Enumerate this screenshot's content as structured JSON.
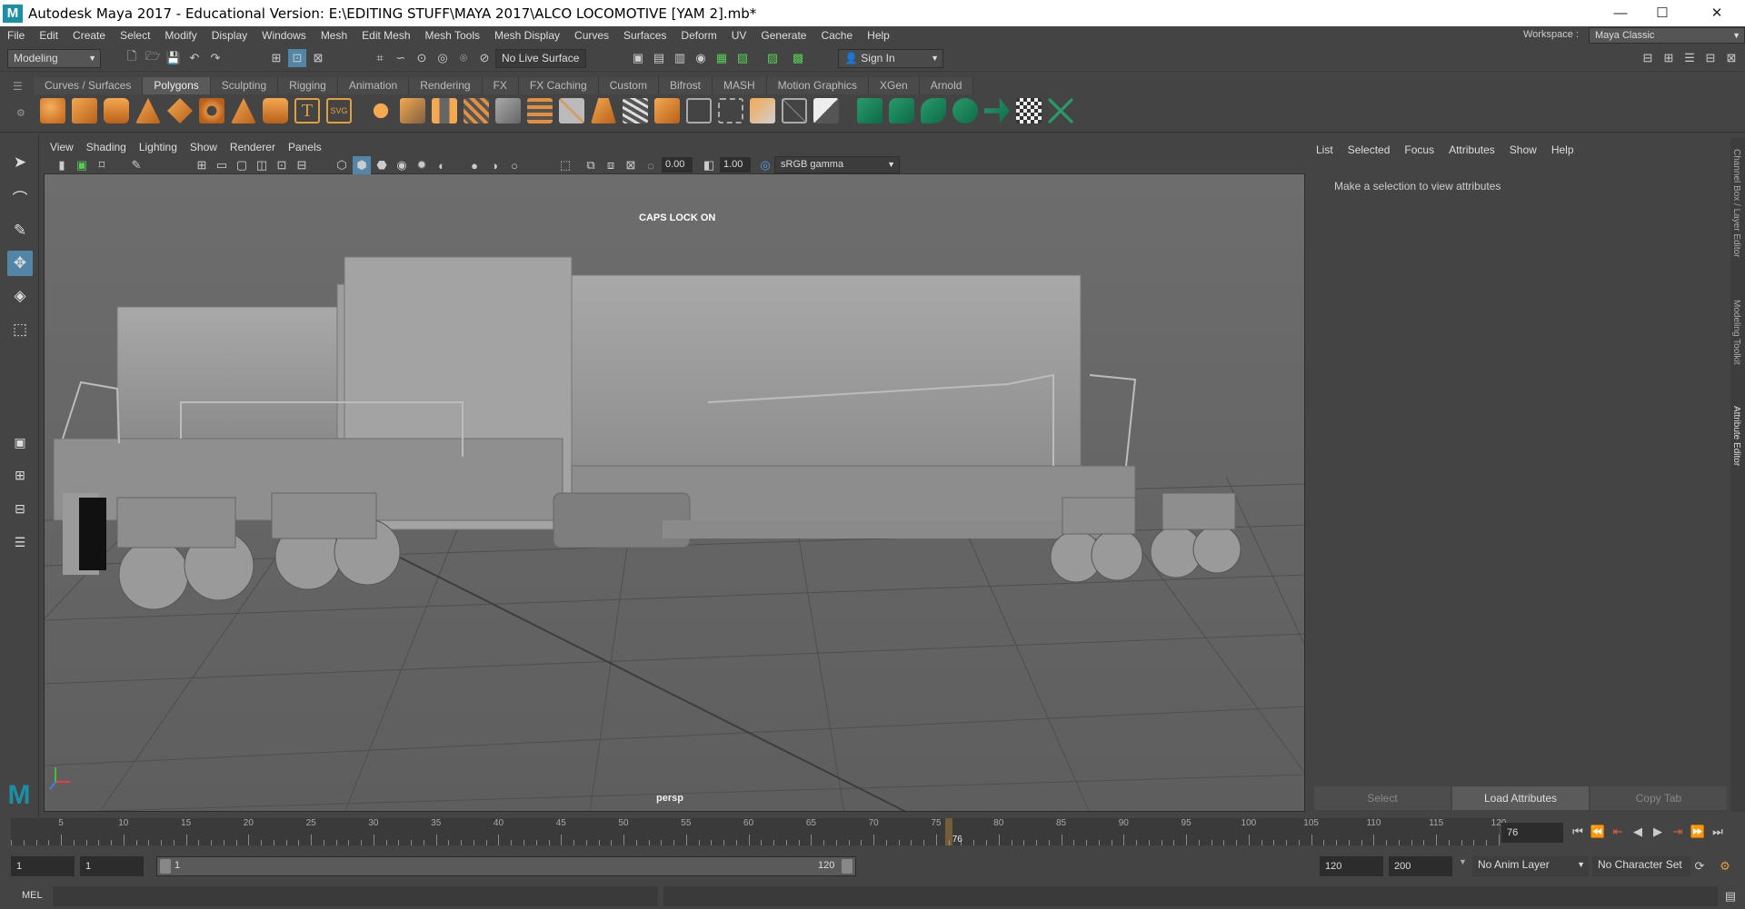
{
  "window": {
    "title": "Autodesk Maya 2017 - Educational Version: E:\\EDITING STUFF\\MAYA 2017\\ALCO LOCOMOTIVE [YAM 2].mb*",
    "logo_letter": "M",
    "min_glyph": "—",
    "max_glyph": "☐",
    "close_glyph": "✕"
  },
  "menubar": {
    "items": [
      "File",
      "Edit",
      "Create",
      "Select",
      "Modify",
      "Display",
      "Windows",
      "Mesh",
      "Edit Mesh",
      "Mesh Tools",
      "Mesh Display",
      "Curves",
      "Surfaces",
      "Deform",
      "UV",
      "Generate",
      "Cache",
      "Help"
    ],
    "workspace_label": "Workspace :",
    "workspace_value": "Maya Classic"
  },
  "toolbar": {
    "mode": "Modeling",
    "live_surface": "No Live Surface",
    "sign_in": "Sign In"
  },
  "shelf": {
    "tabs": [
      "Curves / Surfaces",
      "Polygons",
      "Sculpting",
      "Rigging",
      "Animation",
      "Rendering",
      "FX",
      "FX Caching",
      "Custom",
      "Bifrost",
      "MASH",
      "Motion Graphics",
      "XGen",
      "Arnold"
    ],
    "active_tab": "Polygons",
    "text_tool": "T",
    "svg_tool": "SVG"
  },
  "viewport": {
    "menus": [
      "View",
      "Shading",
      "Lighting",
      "Show",
      "Renderer",
      "Panels"
    ],
    "exposure": "0.00",
    "gamma": "1.00",
    "color_space": "sRGB gamma",
    "caps_lock": "CAPS LOCK ON",
    "camera": "persp",
    "maya_logo": "M"
  },
  "attribute_editor": {
    "menus": [
      "List",
      "Selected",
      "Focus",
      "Attributes",
      "Show",
      "Help"
    ],
    "message": "Make a selection to view attributes",
    "buttons": [
      "Select",
      "Load Attributes",
      "Copy Tab"
    ],
    "active_button": "Load Attributes"
  },
  "side_tabs": [
    "Channel Box / Layer Editor",
    "Modeling Toolkit",
    "Attribute Editor"
  ],
  "timeline": {
    "labels": [
      "5",
      "10",
      "15",
      "20",
      "25",
      "30",
      "35",
      "40",
      "45",
      "50",
      "55",
      "60",
      "65",
      "70",
      "75",
      "80",
      "85",
      "90",
      "95",
      "100",
      "105",
      "110",
      "115",
      "120"
    ],
    "current_frame": "76",
    "current_frame_field": "76",
    "start": 1,
    "end": 120
  },
  "range": {
    "start_field": "1",
    "start_playback": "1",
    "slider_start": "1",
    "slider_end": "120",
    "end_playback": "120",
    "end_field": "200",
    "anim_layer": "No Anim Layer",
    "char_set": "No Character Set"
  },
  "command": {
    "label": "MEL"
  },
  "colors": {
    "accent": "#5285a6",
    "viewport_bg": "#6c6c6c",
    "grid": "#4a4a4a",
    "current_frame_marker": "#e0a040"
  }
}
